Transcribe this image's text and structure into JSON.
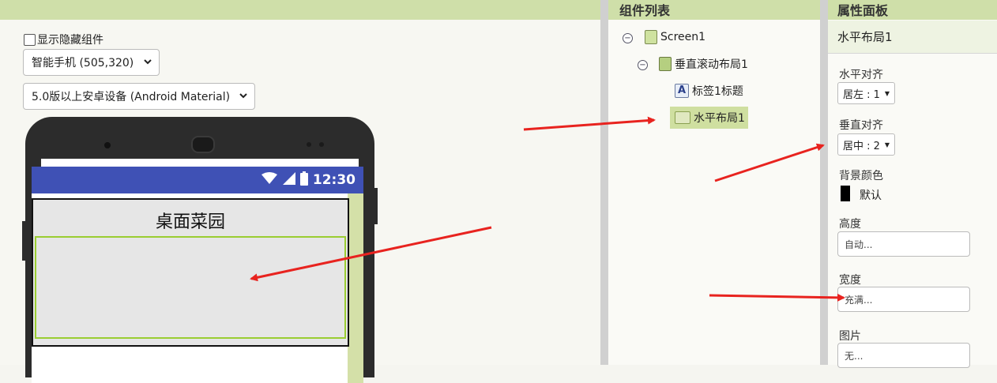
{
  "viewer": {
    "show_hidden_label": "显示隐藏组件",
    "device_size_select": "智能手机 (505,320)",
    "theme_select": "5.0版以上安卓设备 (Android Material)"
  },
  "phone": {
    "clock": "12:30",
    "label_text": "桌面菜园"
  },
  "components": {
    "title": "组件列表",
    "tree": [
      {
        "label": "Screen1",
        "icon": "screen-icon"
      },
      {
        "label": "垂直滚动布局1",
        "icon": "vertical-scroll-arrangement-icon"
      },
      {
        "label": "标签1标题",
        "icon": "label-icon"
      },
      {
        "label": "水平布局1",
        "icon": "horizontal-arrangement-icon",
        "selected": true
      }
    ]
  },
  "properties": {
    "title": "属性面板",
    "component_name": "水平布局1",
    "align_horizontal_label": "水平对齐",
    "align_horizontal_value": "居左 : 1",
    "align_vertical_label": "垂直对齐",
    "align_vertical_value": "居中 : 2",
    "bg_color_label": "背景颜色",
    "bg_color_value": "默认",
    "height_label": "高度",
    "height_value": "自动...",
    "width_label": "宽度",
    "width_value": "充满...",
    "image_label": "图片",
    "image_value": "无..."
  },
  "colors": {
    "header_green": "#cfdfa9",
    "status_bar": "#3f51b5",
    "arrow_red": "#e8231f",
    "selection_green": "#9acd32"
  }
}
